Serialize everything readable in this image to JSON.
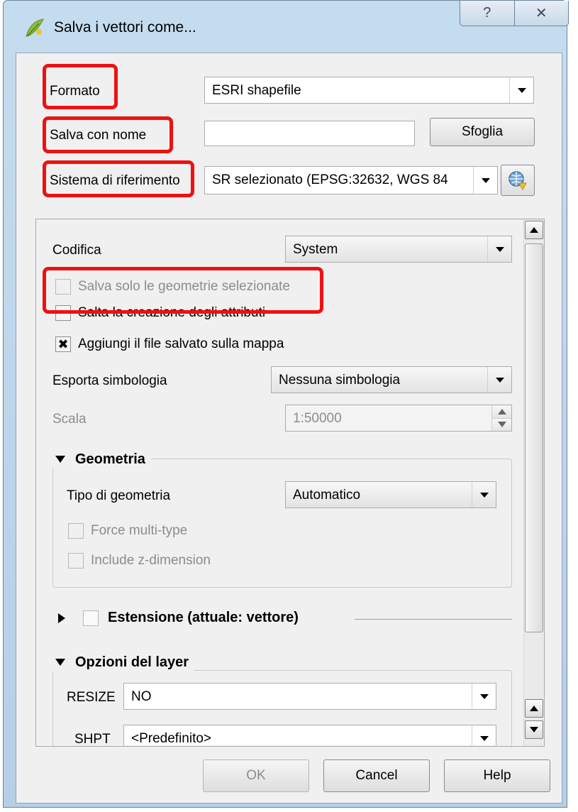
{
  "window": {
    "title": "Salva i vettori come...",
    "help_glyph": "?",
    "close_glyph": "✕"
  },
  "form": {
    "format_label": "Formato",
    "format_value": "ESRI shapefile",
    "filename_label": "Salva con nome",
    "filename_value": "",
    "browse_label": "Sfoglia",
    "crs_label": "Sistema di riferimento",
    "crs_value": "SR selezionato (EPSG:32632, WGS 84"
  },
  "options": {
    "encoding_label": "Codifica",
    "encoding_value": "System",
    "selected_only_label": "Salva solo le geometrie selezionate",
    "selected_only_checked": false,
    "skip_attributes_label": "Salta la creazione degli attributi",
    "skip_attributes_checked": false,
    "add_to_map_label": "Aggiungi il file salvato sulla mappa",
    "add_to_map_checked": true,
    "add_to_map_mark": "✖",
    "symbology_label": "Esporta simbologia",
    "symbology_value": "Nessuna simbologia",
    "scale_label": "Scala",
    "scale_value": "1:50000"
  },
  "geometry_group": {
    "title": "Geometria",
    "type_label": "Tipo di geometria",
    "type_value": "Automatico",
    "force_multi_label": "Force multi-type",
    "include_z_label": "Include z-dimension"
  },
  "extent_group": {
    "title": "Estensione (attuale: vettore)"
  },
  "layer_options_group": {
    "title": "Opzioni del layer",
    "rows": [
      {
        "label": "RESIZE",
        "value": "NO"
      },
      {
        "label": "SHPT",
        "value": "<Predefinito>"
      }
    ]
  },
  "buttons": {
    "ok": "OK",
    "cancel": "Cancel",
    "help": "Help"
  },
  "colors": {
    "highlight": "#ee1111",
    "titlebar": "#c5dcef"
  }
}
